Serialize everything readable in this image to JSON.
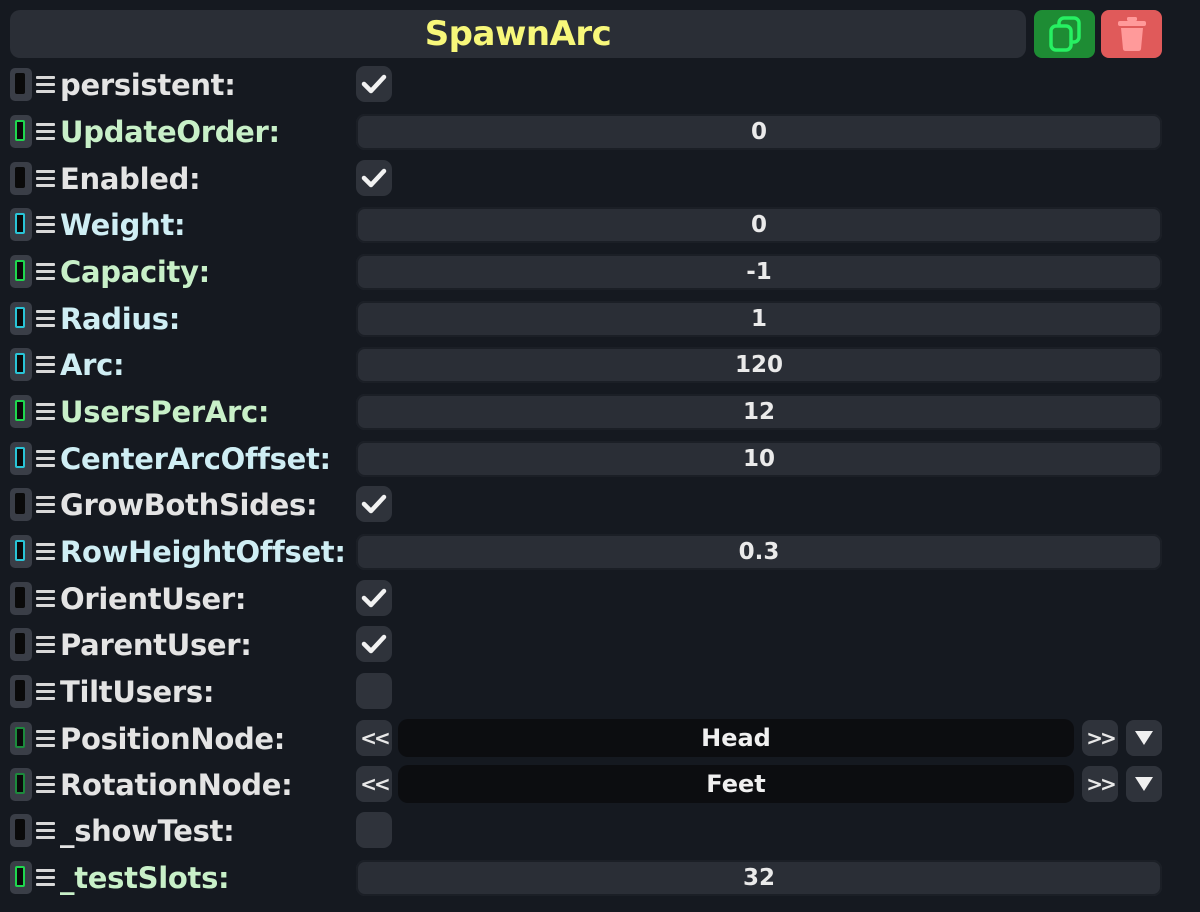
{
  "header": {
    "title": "SpawnArc",
    "duplicate_icon": "duplicate-icon",
    "delete_icon": "trash-icon"
  },
  "colors": {
    "title": "#f7f77a",
    "duplicate_bg": "#1e8c34",
    "delete_bg": "#e05a5a",
    "drive_green": "#1fd64e",
    "drive_cyan": "#29c4d6"
  },
  "rows": [
    {
      "label": "persistent:",
      "type": "bool",
      "checked": true
    },
    {
      "label": "UpdateOrder:",
      "type": "value",
      "value": "0"
    },
    {
      "label": "Enabled:",
      "type": "bool",
      "checked": true
    },
    {
      "label": "Weight:",
      "type": "value",
      "value": "0"
    },
    {
      "label": "Capacity:",
      "type": "value",
      "value": "-1"
    },
    {
      "label": "Radius:",
      "type": "value",
      "value": "1"
    },
    {
      "label": "Arc:",
      "type": "value",
      "value": "120"
    },
    {
      "label": "UsersPerArc:",
      "type": "value",
      "value": "12"
    },
    {
      "label": "CenterArcOffset:",
      "type": "value",
      "value": "10"
    },
    {
      "label": "GrowBothSides:",
      "type": "bool",
      "checked": true
    },
    {
      "label": "RowHeightOffset:",
      "type": "value",
      "value": "0.3"
    },
    {
      "label": "OrientUser:",
      "type": "bool",
      "checked": true
    },
    {
      "label": "ParentUser:",
      "type": "bool",
      "checked": true
    },
    {
      "label": "TiltUsers:",
      "type": "bool",
      "checked": false
    },
    {
      "label": "PositionNode:",
      "type": "enum",
      "value": "Head",
      "prev": "<<",
      "next": ">>"
    },
    {
      "label": "RotationNode:",
      "type": "enum",
      "value": "Feet",
      "prev": "<<",
      "next": ">>"
    },
    {
      "label": "_showTest:",
      "type": "bool",
      "checked": false
    },
    {
      "label": "_testSlots:",
      "type": "value",
      "value": "32"
    }
  ]
}
